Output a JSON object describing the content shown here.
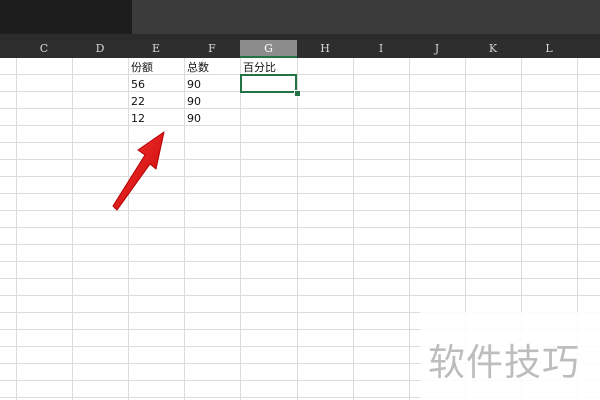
{
  "columns": [
    "C",
    "D",
    "E",
    "F",
    "G",
    "H",
    "I",
    "J",
    "K",
    "L",
    ""
  ],
  "selected_column": "G",
  "cells": {
    "E1": "份额",
    "F1": "总数",
    "G1": "百分比",
    "E2": "56",
    "F2": "90",
    "E3": "22",
    "F3": "90",
    "E4": "12",
    "F4": "90"
  },
  "watermark": "软件技巧",
  "colors": {
    "accent": "#217346",
    "arrow": "#e02020"
  }
}
